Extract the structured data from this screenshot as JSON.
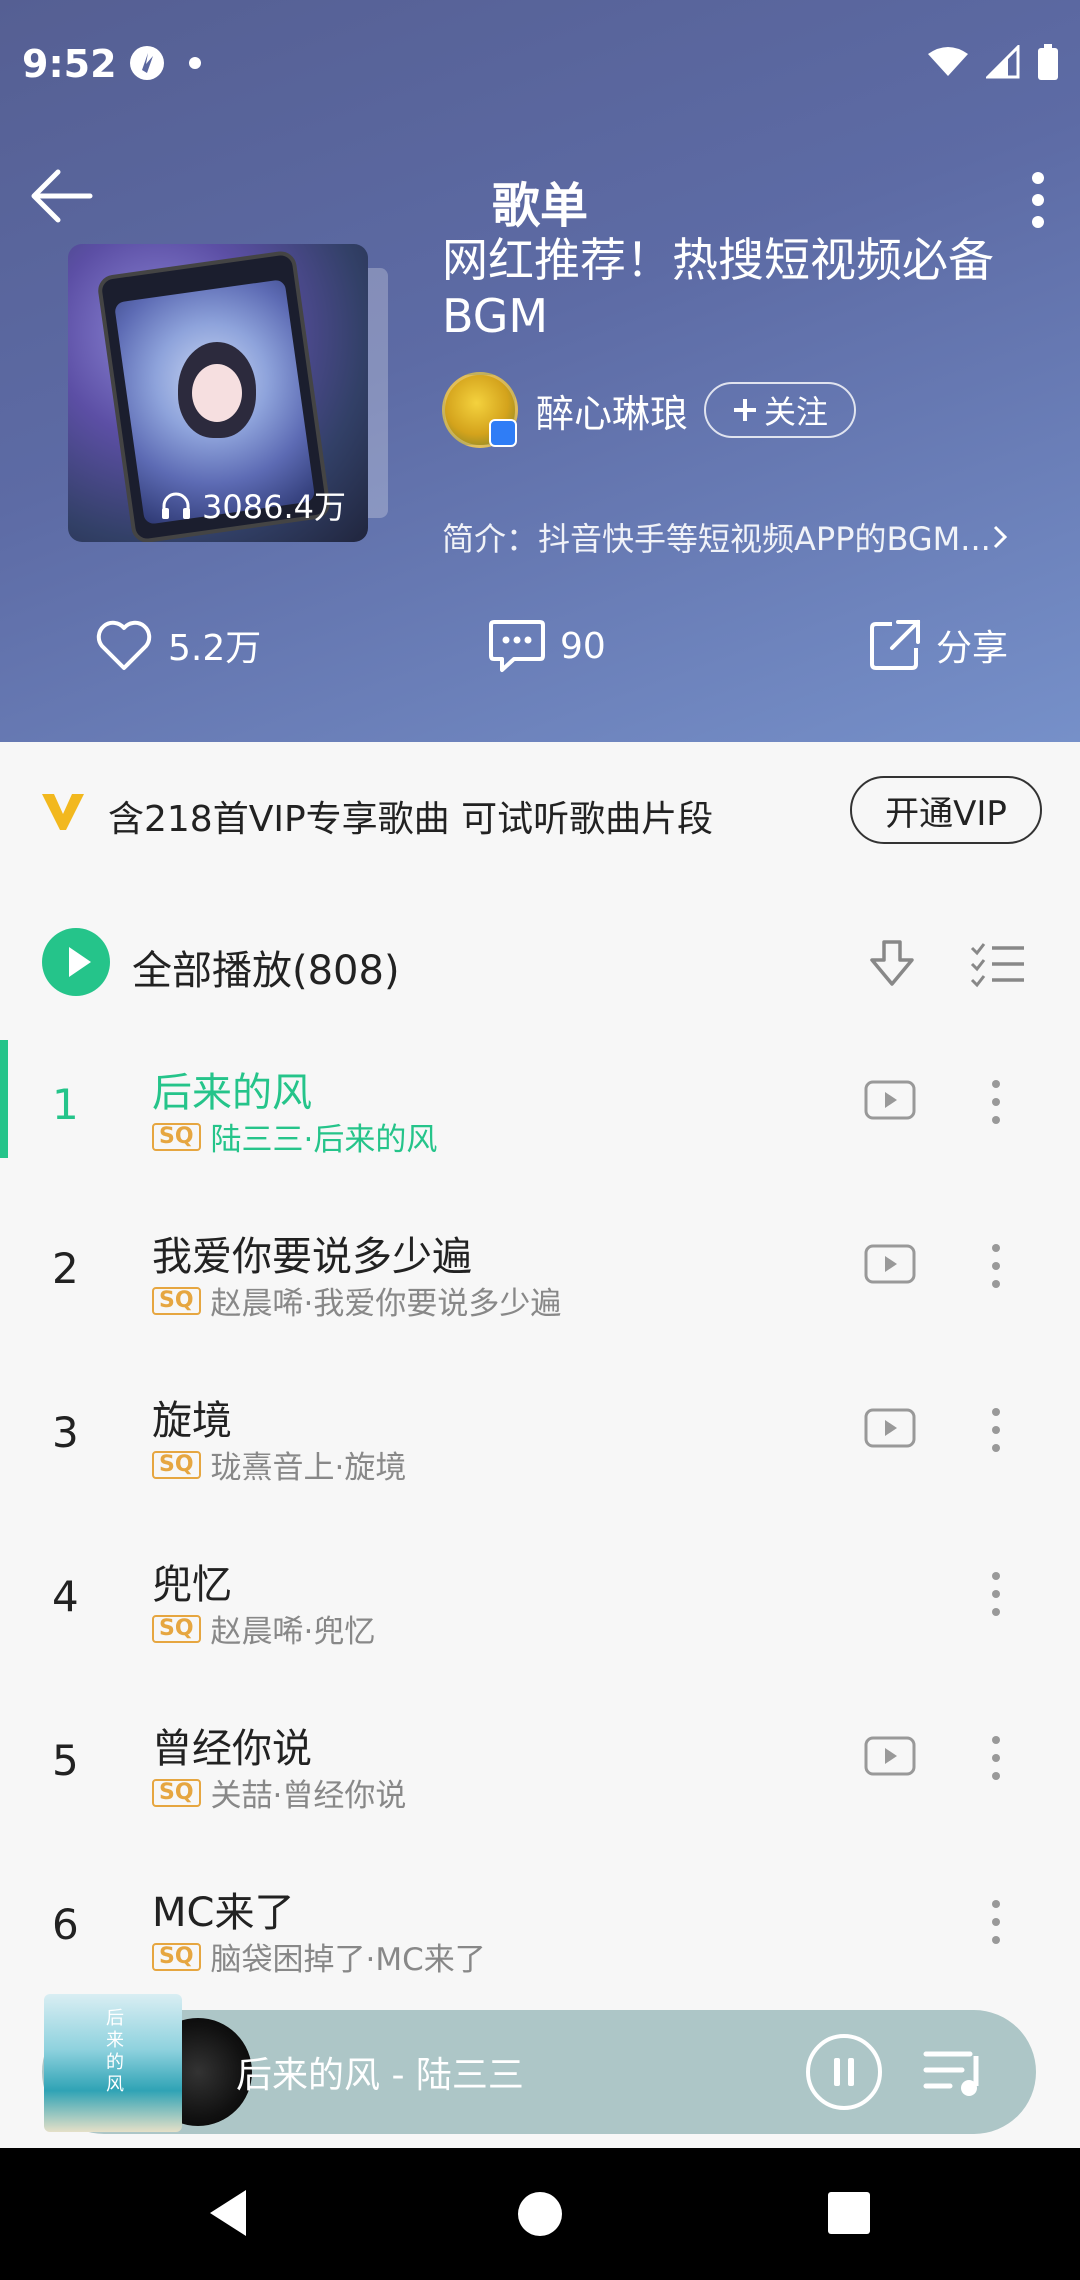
{
  "status": {
    "time": "9:52"
  },
  "nav": {
    "title": "歌单"
  },
  "playlist": {
    "title": "网红推荐！热搜短视频必备BGM",
    "play_count": "3086.4万",
    "creator": "醉心琳琅",
    "follow_label": "关注",
    "intro": "简介：抖音快手等短视频APP的BGM..."
  },
  "actions": {
    "likes": "5.2万",
    "comments": "90",
    "share": "分享"
  },
  "vip": {
    "text": "含218首VIP专享歌曲 可试听歌曲片段",
    "button": "开通VIP"
  },
  "play_all": {
    "label": "全部播放(808)"
  },
  "songs": [
    {
      "num": "1",
      "title": "后来的风",
      "sub": "陆三三·后来的风",
      "badge": "SQ",
      "mv": true
    },
    {
      "num": "2",
      "title": "我爱你要说多少遍",
      "sub": "赵晨唏·我爱你要说多少遍",
      "badge": "SQ",
      "mv": true
    },
    {
      "num": "3",
      "title": "旋境",
      "sub": "珑熹音上·旋境",
      "badge": "SQ",
      "mv": true
    },
    {
      "num": "4",
      "title": "兜忆",
      "sub": "赵晨唏·兜忆",
      "badge": "SQ",
      "mv": false
    },
    {
      "num": "5",
      "title": "曾经你说",
      "sub": "关喆·曾经你说",
      "badge": "SQ",
      "mv": true
    },
    {
      "num": "6",
      "title": "MC来了",
      "sub": "脑袋困掉了·MC来了",
      "badge": "SQ",
      "mv": false
    }
  ],
  "mini_player": {
    "title": "后来的风 - 陆三三",
    "art_text": "后来的风"
  },
  "colors": {
    "accent": "#25c48a",
    "header_start": "#555f93",
    "header_end": "#7690c9",
    "vip": "#e6a640"
  }
}
